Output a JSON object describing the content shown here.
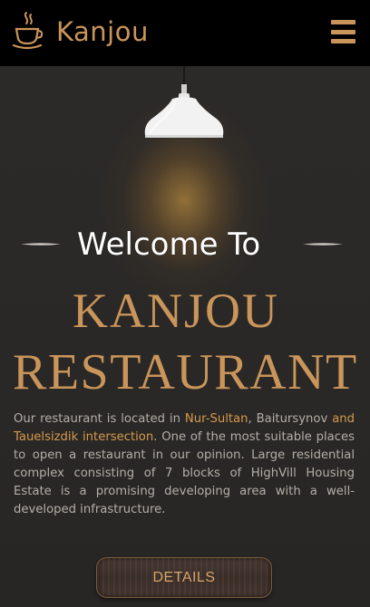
{
  "navbar": {
    "brand": "Kanjou",
    "brand_icon": "coffee-cup-icon",
    "menu_icon": "hamburger-menu-icon"
  },
  "hero": {
    "welcome": "Welcome To",
    "title_line1": "KANJOU",
    "title_line2": "RESTAURANT",
    "description": {
      "part1": "Our restaurant is located in ",
      "highlight1": "Nur-Sultan",
      "part2": ", Baitursynov ",
      "highlight2": "and Tauelsizdik intersection",
      "part3": ". One of the most suitable places to open a restaurant in our opinion. Large residential complex consisting of 7 blocks of HighVill Housing Estate is a promising developing area with a well-developed infrastructure."
    },
    "button_label": "DETAILS"
  },
  "colors": {
    "accent": "#c9955a",
    "background": "#2a2826",
    "navbar": "#000000",
    "text": "#b3aea8"
  }
}
